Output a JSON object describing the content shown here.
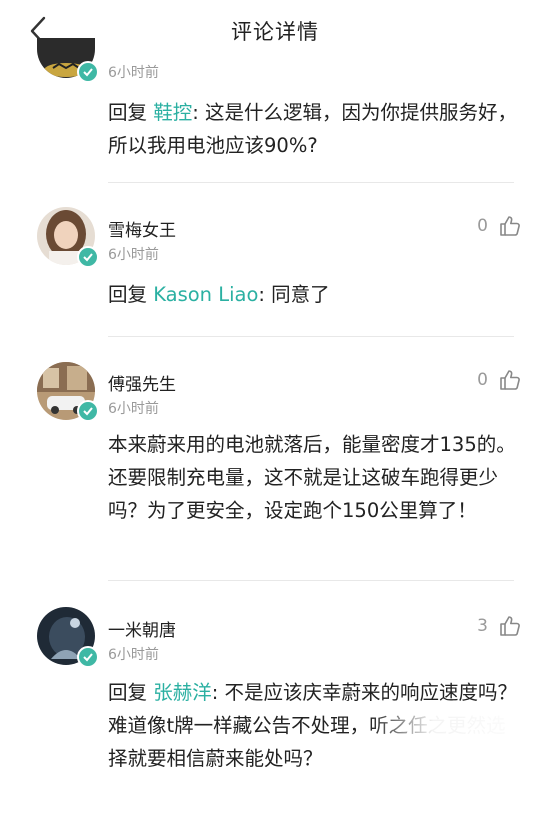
{
  "header": {
    "title": "评论详情",
    "back_icon": "chevron-left-icon"
  },
  "colors": {
    "mention": "#2bb0a2",
    "verified_badge": "#3fb8a5",
    "muted": "#9a9a9a"
  },
  "comments": [
    {
      "time": "6小时前",
      "reply_prefix": "回复 ",
      "mention": "鞋控",
      "text": ": 这是什么逻辑，因为你提供服务好，所以我用电池应该90%?"
    },
    {
      "name": "雪梅女王",
      "time": "6小时前",
      "likes": "0",
      "reply_prefix": "回复 ",
      "mention": "Kason Liao",
      "text": ": 同意了"
    },
    {
      "name": "傅强先生",
      "time": "6小时前",
      "likes": "0",
      "text": "本来蔚来用的电池就落后，能量密度才135的。还要限制充电量，这不就是让这破车跑得更少吗？为了更安全，设定跑个150公里算了！"
    },
    {
      "name": "一米朝唐",
      "time": "6小时前",
      "likes": "3",
      "reply_prefix": "回复 ",
      "mention": "张赫洋",
      "text": ": 不是应该庆幸蔚来的响应速度吗？难道像t牌一样藏公告不处理，听之任之更然选择就要相信蔚来能处吗？"
    }
  ]
}
